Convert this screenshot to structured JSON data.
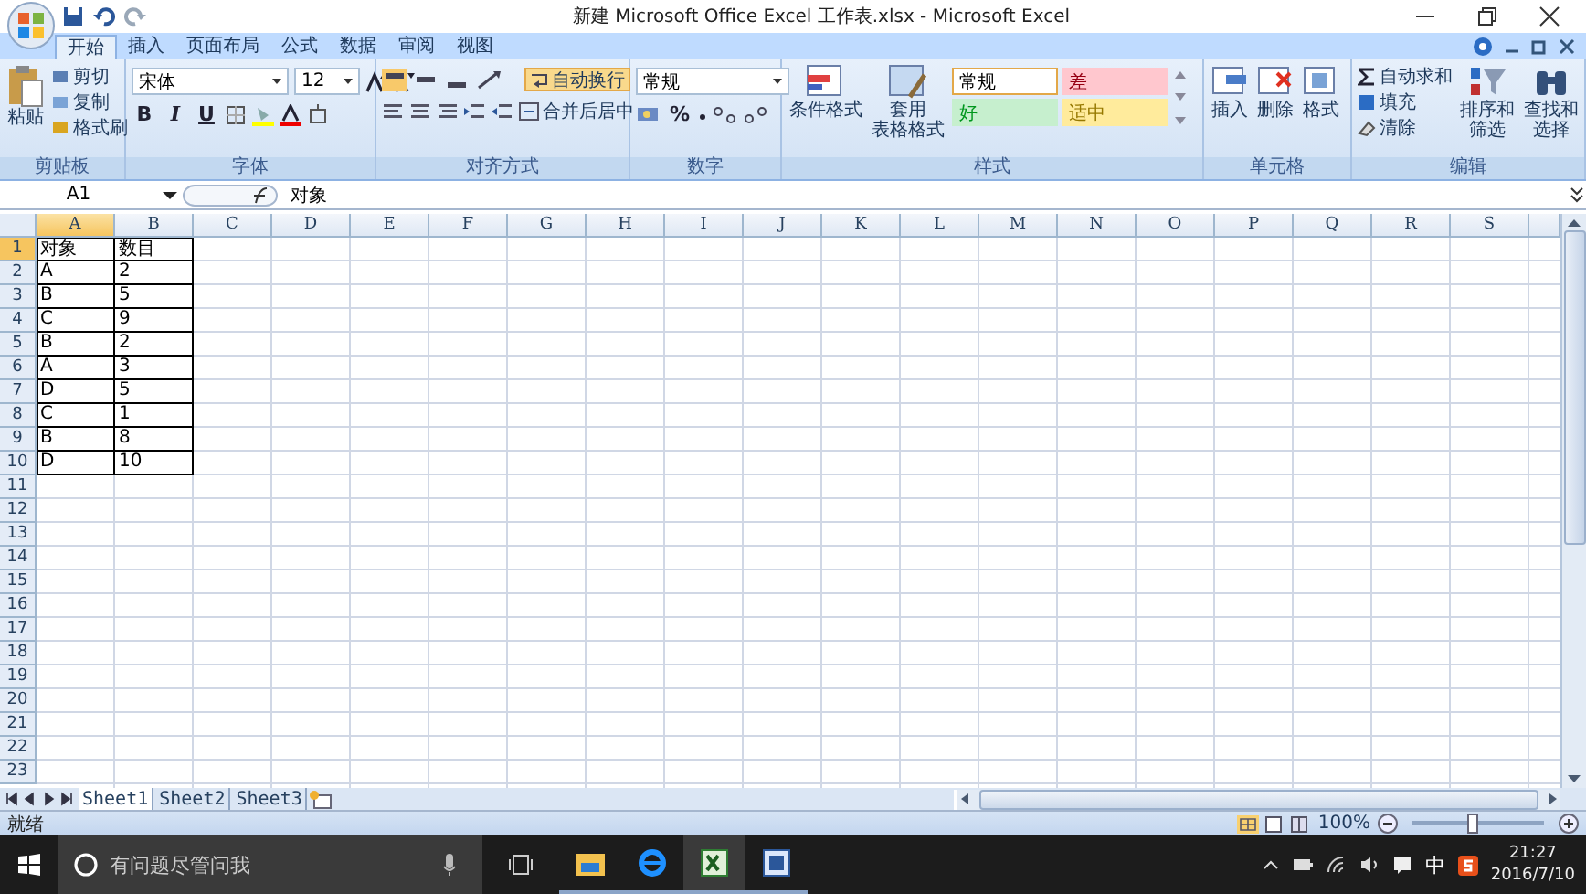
{
  "title_bar": {
    "title": "新建 Microsoft Office Excel 工作表.xlsx - Microsoft Excel"
  },
  "tabs": [
    {
      "label": "开始",
      "selected": true
    },
    {
      "label": "插入",
      "selected": false
    },
    {
      "label": "页面布局",
      "selected": false
    },
    {
      "label": "公式",
      "selected": false
    },
    {
      "label": "数据",
      "selected": false
    },
    {
      "label": "审阅",
      "selected": false
    },
    {
      "label": "视图",
      "selected": false
    }
  ],
  "ribbon": {
    "clipboard": {
      "paste": "粘贴",
      "actions": [
        "剪切",
        "复制",
        "格式刷"
      ],
      "label": "剪贴板"
    },
    "font": {
      "name": "宋体",
      "size": "12",
      "styles": [
        "B",
        "I",
        "U"
      ],
      "label": "字体"
    },
    "alignment": {
      "wrap_text": "自动换行",
      "merge": "合并后居中",
      "label": "对齐方式"
    },
    "number": {
      "format": "常规",
      "percent": "%",
      "label": "数字"
    },
    "styles": {
      "conditional": "条件格式",
      "table_format": [
        "套用",
        "表格格式"
      ],
      "label": "样式",
      "cells": [
        {
          "label": "常规",
          "color": "#ffffff",
          "selected": true
        },
        {
          "label": "差",
          "color": "#ffc7ce",
          "selected": false
        },
        {
          "label": "好",
          "color": "#c6efce",
          "selected": false
        },
        {
          "label": "适中",
          "color": "#ffeb9c",
          "selected": false
        }
      ]
    },
    "cells": {
      "buttons": [
        "插入",
        "删除",
        "格式"
      ],
      "label": "单元格"
    },
    "editing": {
      "actions": [
        "自动求和",
        "填充",
        "清除"
      ],
      "sort": [
        "排序和",
        "筛选"
      ],
      "find": [
        "查找和",
        "选择"
      ],
      "label": "编辑"
    }
  },
  "formula_bar": {
    "name_box": "A1",
    "value": "对象"
  },
  "sheet": {
    "columns": [
      {
        "label": "A",
        "selected": true
      },
      {
        "label": "B",
        "selected": false
      },
      {
        "label": "C",
        "selected": false
      },
      {
        "label": "D",
        "selected": false
      },
      {
        "label": "E",
        "selected": false
      },
      {
        "label": "F",
        "selected": false
      },
      {
        "label": "G",
        "selected": false
      },
      {
        "label": "H",
        "selected": false
      },
      {
        "label": "I",
        "selected": false
      },
      {
        "label": "J",
        "selected": false
      },
      {
        "label": "K",
        "selected": false
      },
      {
        "label": "L",
        "selected": false
      },
      {
        "label": "M",
        "selected": false
      },
      {
        "label": "N",
        "selected": false
      },
      {
        "label": "O",
        "selected": false
      },
      {
        "label": "P",
        "selected": false
      },
      {
        "label": "Q",
        "selected": false
      },
      {
        "label": "R",
        "selected": false
      },
      {
        "label": "S",
        "selected": false
      }
    ],
    "rows": [
      {
        "number": "1",
        "selected": true,
        "cells": [
          "对象",
          "数目"
        ]
      },
      {
        "number": "2",
        "selected": false,
        "cells": [
          "A",
          "2"
        ]
      },
      {
        "number": "3",
        "selected": false,
        "cells": [
          "B",
          "5"
        ]
      },
      {
        "number": "4",
        "selected": false,
        "cells": [
          "C",
          "9"
        ]
      },
      {
        "number": "5",
        "selected": false,
        "cells": [
          "B",
          "2"
        ]
      },
      {
        "number": "6",
        "selected": false,
        "cells": [
          "A",
          "3"
        ]
      },
      {
        "number": "7",
        "selected": false,
        "cells": [
          "D",
          "5"
        ]
      },
      {
        "number": "8",
        "selected": false,
        "cells": [
          "C",
          "1"
        ]
      },
      {
        "number": "9",
        "selected": false,
        "cells": [
          "B",
          "8"
        ]
      },
      {
        "number": "10",
        "selected": false,
        "cells": [
          "D",
          "10"
        ]
      },
      {
        "number": "11",
        "selected": false
      },
      {
        "number": "12",
        "selected": false
      },
      {
        "number": "13",
        "selected": false
      },
      {
        "number": "14",
        "selected": false
      },
      {
        "number": "15",
        "selected": false
      },
      {
        "number": "16",
        "selected": false
      },
      {
        "number": "17",
        "selected": false
      },
      {
        "number": "18",
        "selected": false
      },
      {
        "number": "19",
        "selected": false
      },
      {
        "number": "20",
        "selected": false
      },
      {
        "number": "21",
        "selected": false
      },
      {
        "number": "22",
        "selected": false
      },
      {
        "number": "23",
        "selected": false
      }
    ]
  },
  "sheet_tabs": [
    {
      "label": "Sheet1",
      "selected": true
    },
    {
      "label": "Sheet2",
      "selected": false
    },
    {
      "label": "Sheet3",
      "selected": false
    }
  ],
  "status_bar": {
    "status": "就绪",
    "zoom": "100%",
    "zoom_slider": {
      "level": 0.45
    }
  },
  "taskbar": {
    "search_placeholder": "有问题尽管问我",
    "ime": "中",
    "time": "21:27",
    "date": "2016/7/10"
  }
}
